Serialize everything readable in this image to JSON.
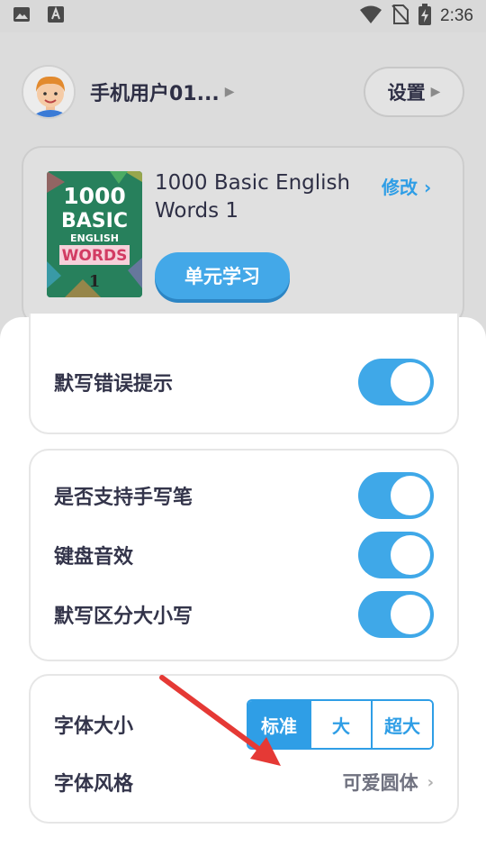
{
  "status_bar": {
    "time": "2:36",
    "icons": [
      "image-icon",
      "text-a-icon",
      "wifi-icon",
      "no-sim-icon",
      "battery-charging-icon"
    ]
  },
  "profile": {
    "username": "手机用户01...",
    "settings_label": "设置"
  },
  "book": {
    "cover_line1": "1000",
    "cover_line2": "BASIC",
    "cover_line3": "ENGLISH",
    "cover_line4": "WORDS",
    "cover_num": "1",
    "title": "1000 Basic English Words 1",
    "modify_label": "修改",
    "unit_study_label": "单元学习"
  },
  "sheet": {
    "group1": {
      "items": [
        {
          "label": "默写错误提示",
          "on": true
        }
      ]
    },
    "group2": {
      "items": [
        {
          "label": "是否支持手写笔",
          "on": true
        },
        {
          "label": "键盘音效",
          "on": true
        },
        {
          "label": "默写区分大小写",
          "on": true
        }
      ]
    },
    "group3": {
      "font_size_label": "字体大小",
      "font_size_options": [
        "标准",
        "大",
        "超大"
      ],
      "font_size_selected": "标准",
      "font_style_label": "字体风格",
      "font_style_value": "可爱圆体"
    }
  },
  "colors": {
    "accent": "#2f9ee6",
    "toggle_on": "#3fa8e8",
    "annotation_arrow": "#e53935"
  }
}
